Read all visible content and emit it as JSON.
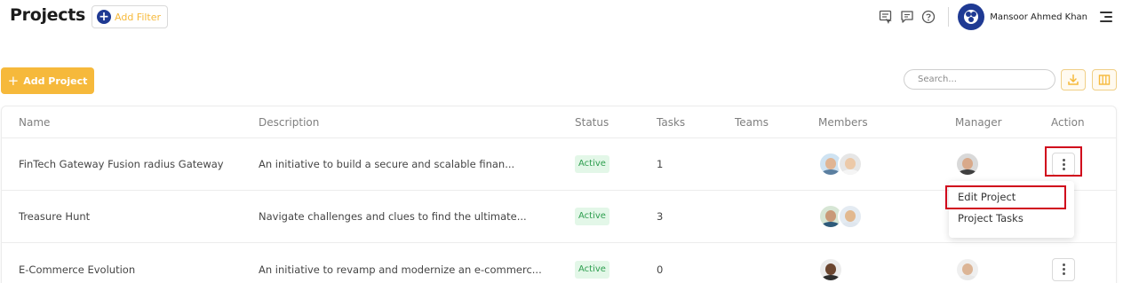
{
  "header": {
    "title": "Projects",
    "add_filter_label": "Add Filter",
    "user_name": "Mansoor Ahmed Khan"
  },
  "toolbar": {
    "add_project_label": "Add Project",
    "search_placeholder": "Search..."
  },
  "table": {
    "columns": [
      "Name",
      "Description",
      "Status",
      "Tasks",
      "Teams",
      "Members",
      "Manager",
      "Action"
    ],
    "rows": [
      {
        "name": "FinTech Gateway Fusion radius Gateway",
        "description": "An initiative to build a secure and scalable finan...",
        "status": "Active",
        "tasks": "1",
        "teams": ""
      },
      {
        "name": "Treasure Hunt",
        "description": "Navigate challenges and clues to find the ultimate...",
        "status": "Active",
        "tasks": "3",
        "teams": ""
      },
      {
        "name": "E-Commerce Evolution",
        "description": "An initiative to revamp and modernize an e-commerc...",
        "status": "Active",
        "tasks": "0",
        "teams": ""
      }
    ]
  },
  "action_menu": {
    "items": [
      "Edit Project",
      "Project Tasks"
    ]
  },
  "colors": {
    "accent": "#f6b93b",
    "brand": "#1f3a93",
    "status_active_bg": "#e3f7e8",
    "status_active_text": "#2e9e4f",
    "highlight": "#d0021b"
  }
}
